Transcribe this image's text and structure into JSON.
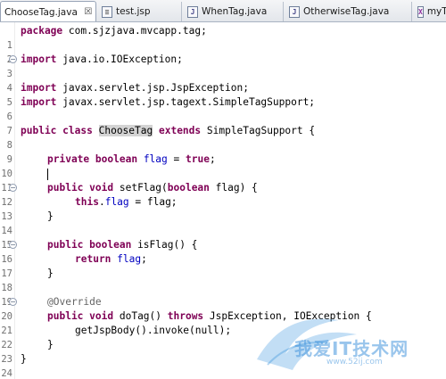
{
  "tabs": [
    {
      "label": "ChooseTag.java",
      "icon": "java-file-icon",
      "active": true,
      "close": "☒"
    },
    {
      "label": "test.jsp",
      "icon": "jsp-file-icon",
      "active": false
    },
    {
      "label": "WhenTag.java",
      "icon": "java-file-icon",
      "active": false
    },
    {
      "label": "OtherwiseTag.java",
      "icon": "java-file-icon",
      "active": false
    },
    {
      "label": "myT",
      "icon": "xml-file-icon",
      "active": false
    }
  ],
  "icon_glyphs": {
    "java": "J",
    "jsp": "≡",
    "xml": "X"
  },
  "fold_glyph": "−",
  "code": {
    "line_numbers": [
      "1",
      "2",
      "3",
      "4",
      "5",
      "6",
      "7",
      "8",
      "9",
      "10",
      "11",
      "12",
      "13",
      "14",
      "15",
      "16",
      "17",
      "18",
      "19",
      "20",
      "21",
      "22",
      "23",
      "24"
    ],
    "l1": {
      "kw": "package",
      "rest": " com.sjzjava.mvcapp.tag;"
    },
    "l3": {
      "kw": "import",
      "rest": " java.io.IOException;"
    },
    "l5": {
      "kw": "import",
      "rest": " javax.servlet.jsp.JspException;"
    },
    "l6": {
      "kw": "import",
      "rest": " javax.servlet.jsp.tagext.SimpleTagSupport;"
    },
    "l8": {
      "kw1": "public",
      "kw2": "class",
      "name": "ChooseTag",
      "kw3": "extends",
      "rest": " SimpleTagSupport {"
    },
    "l10": {
      "kw1": "private",
      "kw2": "boolean",
      "field": "flag",
      "eq": " = ",
      "kw3": "true",
      "end": ";"
    },
    "l12": {
      "kw1": "public",
      "kw2": "void",
      "mid": " setFlag(",
      "kw3": "boolean",
      "end": " flag) {"
    },
    "l13": {
      "kw": "this",
      "dot": ".",
      "field": "flag",
      "end": " = flag;"
    },
    "l14": "}",
    "l16": {
      "kw1": "public",
      "kw2": "boolean",
      "end": " isFlag() {"
    },
    "l17": {
      "kw": "return",
      "field": "flag",
      "end": ";"
    },
    "l18": "}",
    "l20": "@Override",
    "l21": {
      "kw1": "public",
      "kw2": "void",
      "mid": " doTag() ",
      "kw3": "throws",
      "end": " JspException, IOException {"
    },
    "l22": "getJspBody().invoke(null);",
    "l23": "}",
    "l24": "}"
  },
  "watermark": {
    "text": "我爱IT技术网",
    "url": "www.52ij.com"
  }
}
